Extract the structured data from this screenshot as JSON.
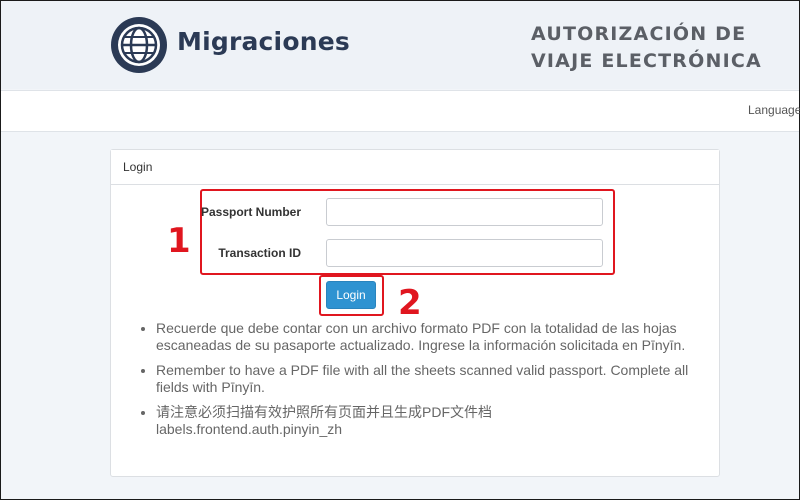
{
  "header": {
    "brand": "Migraciones",
    "auth_title_line1": "AUTORIZACIÓN DE",
    "auth_title_line2": "VIAJE ELECTRÓNICA"
  },
  "navbar": {
    "language_label": "Language"
  },
  "login_card": {
    "title": "Login",
    "passport_label": "Passport Number",
    "passport_value": "",
    "transaction_label": "Transaction ID",
    "transaction_value": "",
    "login_button": "Login"
  },
  "annotations": {
    "marker_1": "1",
    "marker_2": "2",
    "color": "#e0161f"
  },
  "notes": [
    {
      "text": "Recuerde que debe contar con un archivo formato PDF con la totalidad de las hojas escaneadas de su pasaporte actualizado. Ingrese la información solicitada en Pīnyīn."
    },
    {
      "text": "Remember to have a PDF file with all the sheets scanned valid passport. Complete all fields with Pīnyīn."
    },
    {
      "text": "请注意必须扫描有效护照所有页面并且生成PDF文件档",
      "sub": "labels.frontend.auth.pinyin_zh"
    }
  ],
  "colors": {
    "brand_navy": "#2b3a55",
    "button_blue": "#2f93d1"
  },
  "icons": {
    "logo": "globe-logo-icon"
  }
}
